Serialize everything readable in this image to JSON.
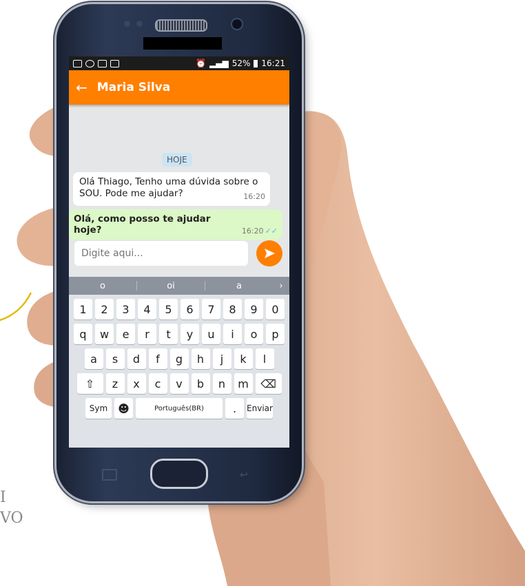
{
  "status_bar": {
    "battery": "52%",
    "time": "16:21"
  },
  "app_bar": {
    "back_icon": "arrow-left-icon",
    "title": "Maria Silva"
  },
  "chat": {
    "day_divider": "HOJE",
    "messages": [
      {
        "direction": "incoming",
        "text": "Olá Thiago, Tenho uma dúvida sobre o SOU. Pode me ajudar?",
        "time": "16:20"
      },
      {
        "direction": "outgoing",
        "text": "Olá, como posso te ajudar hoje?",
        "time": "16:20",
        "status": "read"
      }
    ]
  },
  "composer": {
    "placeholder": "Digite aqui...",
    "send_icon": "send-icon"
  },
  "keyboard": {
    "suggestions": [
      "o",
      "oi",
      "a"
    ],
    "row_numbers": [
      "1",
      "2",
      "3",
      "4",
      "5",
      "6",
      "7",
      "8",
      "9",
      "0"
    ],
    "row_1": [
      "q",
      "w",
      "e",
      "r",
      "t",
      "y",
      "u",
      "i",
      "o",
      "p"
    ],
    "row_2": [
      "a",
      "s",
      "d",
      "f",
      "g",
      "h",
      "j",
      "k",
      "l"
    ],
    "row_3": [
      "z",
      "x",
      "c",
      "v",
      "b",
      "n",
      "m"
    ],
    "sym_label": "Sym",
    "space_label": "Português(BR)",
    "period_label": ".",
    "enter_label": "Enviar"
  },
  "colors": {
    "accent": "#ff7f00",
    "outgoing_bubble": "#dcf8c6",
    "incoming_bubble": "#ffffff",
    "chat_bg": "#e4e6e8"
  }
}
